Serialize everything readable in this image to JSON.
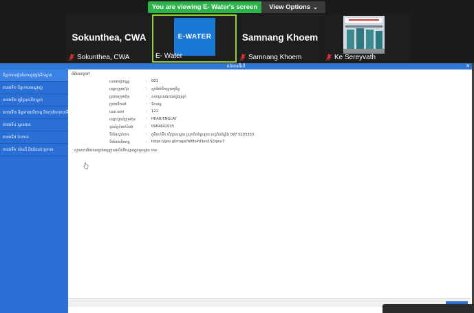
{
  "banner": {
    "sharing_text": "You are viewing E- Water's screen",
    "view_options_label": "View Options",
    "view_options_icon": "chevron-down-icon"
  },
  "participants": [
    {
      "display_name": "Sokunthea, CWA",
      "label": "Sokunthea, CWA",
      "muted": true
    },
    {
      "display_name": "",
      "label": "E- Water",
      "muted": false,
      "avatar_text": "E-WATER",
      "active_speaker": true
    },
    {
      "display_name": "Samnang Khoem",
      "label": "Samnang Khoem",
      "muted": true
    },
    {
      "display_name": "",
      "label": "Ke Sereyvath",
      "muted": true
    }
  ],
  "shared_window": {
    "title": "ពត៌មានអ៊ីលី",
    "sidebar": [
      "និន្នាការលម្អិតនៃការផ្គត់ផ្គង់ទឹកស្អាត",
      "តារាងទី១ និន្នាការតបណ្ដាញ",
      "តារាងទី២ ប្រើប្រាស់ទឹកស្អាត",
      "តារាងទី៣ និន្នាការផលិតកម្ម និងការចែកចាយទឹក",
      "តារាងទី៤ ស្ថានភាព",
      "តារាងទី៥ ប៉ះពាល់",
      "តារាងទី៦ សំណើ និងដំណោះស្រាយ"
    ],
    "content": {
      "group_title": "ព័ត៌មានទូទៅ",
      "rows": [
        {
          "label": "លេខអាជ្ញាបណ្ណ",
          "value": "001"
        },
        {
          "label": "ឈ្មោះក្រុមហ៊ុន",
          "value": "ស្ថានីយ៍ទឹកស្អាតកូនីទ្ធ"
        },
        {
          "label": "ប្រភេទក្រុមហ៊ុន",
          "value": "សហគ្រាសឯកជនក្នុងស្រុក"
        },
        {
          "label": "ប្រភពទឹកឆៅ",
          "value": "ទឹកទន្លេ"
        },
        {
          "label": "លេខ អតប",
          "value": "121"
        },
        {
          "label": "ឈ្មោះម្ចាស់ក្រុមហ៊ុន",
          "value": "HEAN ENGLAY"
        },
        {
          "label": "ទូរស័ព្ទទំនាក់ទំនង",
          "value": "0964642015"
        },
        {
          "label": "ទីតាំងស្នាក់ការ",
          "value": "ភូមិចាក់ទឹក ឃុំក្បាលស្ពាន ស្រុកកំពង់ត្រឡាច ខេត្តកំពង់ឆ្នាំង 097 5293333"
        },
        {
          "label": "ទីតាំងផលិតកម្ម",
          "value": "https://goo.gl/maps/Wf8oPd3eo1SZqwu7"
        },
        {
          "label": "សូចនាករមិនមានច្បាប់អនុញ្ញាតផលិតទឹកស្អាតក្នុងមូលដ្ឋាន",
          "value": "មាន"
        }
      ]
    }
  },
  "colors": {
    "share_green": "#2db34a",
    "ui_dark": "#1b1b1b",
    "sidebar_blue": "#2a6fd6",
    "active_border": "#9acd32",
    "mute_red": "#e0322b"
  }
}
